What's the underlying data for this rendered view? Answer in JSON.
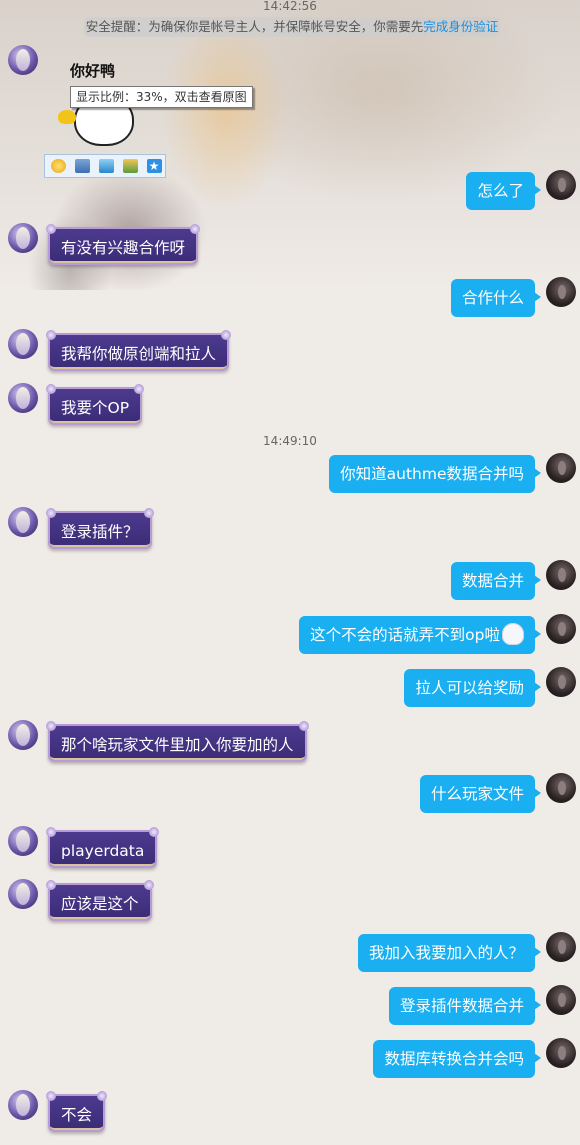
{
  "chat": {
    "time_top": "14:42:56",
    "notice": {
      "text": "安全提醒：为确保你是帐号主人，并保障帐号安全，你需要先",
      "link": "完成身份验证"
    },
    "sticker": {
      "text": "你好鸭",
      "tooltip": "显示比例：33%，双击查看原图"
    },
    "time_mid": "14:49:10",
    "messages": [
      {
        "side": "right",
        "text": "怎么了"
      },
      {
        "side": "left",
        "text": "有没有兴趣合作呀"
      },
      {
        "side": "right",
        "text": "合作什么"
      },
      {
        "side": "left",
        "text": "我帮你做原创端和拉人"
      },
      {
        "side": "left",
        "text": "我要个OP"
      },
      {
        "side": "right",
        "text": "你知道authme数据合并吗"
      },
      {
        "side": "left",
        "text": "登录插件？"
      },
      {
        "side": "right",
        "text": "数据合并"
      },
      {
        "side": "right",
        "text": "这个不会的话就弄不到op啦"
      },
      {
        "side": "right",
        "text": "拉人可以给奖励"
      },
      {
        "side": "left",
        "text": "那个啥玩家文件里加入你要加的人"
      },
      {
        "side": "right",
        "text": "什么玩家文件"
      },
      {
        "side": "left",
        "text": "playerdata"
      },
      {
        "side": "left",
        "text": "应该是这个"
      },
      {
        "side": "right",
        "text": "我加入我要加入的人？"
      },
      {
        "side": "right",
        "text": "登录插件数据合并"
      },
      {
        "side": "right",
        "text": "数据库转换合并会吗"
      },
      {
        "side": "left",
        "text": "不会"
      }
    ]
  },
  "toolbar_icons": [
    "emoji-icon",
    "save-icon",
    "display-icon",
    "image-edit-icon",
    "favorite-star-icon"
  ],
  "colors": {
    "self_bubble": "#1aaff0",
    "peer_bubble": "#3a2c76"
  }
}
